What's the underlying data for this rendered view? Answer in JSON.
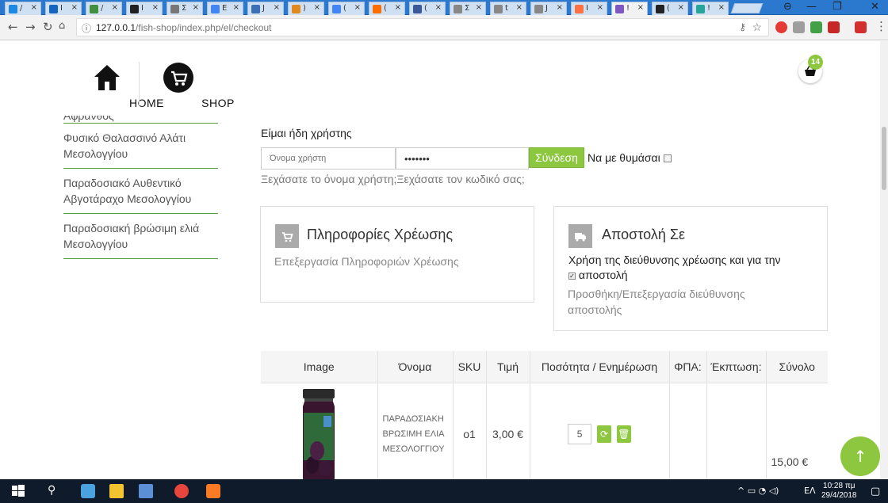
{
  "browser": {
    "tabs": [
      {
        "label": "/",
        "color": "#1e88e5"
      },
      {
        "label": "I",
        "color": "#1565c0"
      },
      {
        "label": "/",
        "color": "#3f8f3f"
      },
      {
        "label": "I",
        "color": "#222222"
      },
      {
        "label": "Σ",
        "color": "#777777"
      },
      {
        "label": "E",
        "color": "#4285f4"
      },
      {
        "label": "J",
        "color": "#3b6fb6"
      },
      {
        "label": ")",
        "color": "#e08a1e"
      },
      {
        "label": "(",
        "color": "#4285f4"
      },
      {
        "label": "(",
        "color": "#ff6d00"
      },
      {
        "label": "(",
        "color": "#3b5998"
      },
      {
        "label": "Σ",
        "color": "#888888"
      },
      {
        "label": "t",
        "color": "#888888"
      },
      {
        "label": "J",
        "color": "#888888"
      },
      {
        "label": "I",
        "color": "#ff7043"
      },
      {
        "label": "!",
        "color": "#7e57c2"
      },
      {
        "label": "(",
        "color": "#222222"
      },
      {
        "label": "!",
        "color": "#26a69a"
      }
    ],
    "url_host": "127.0.0.1",
    "url_path": "/fish-shop/index.php/el/checkout"
  },
  "nav": {
    "home_label": "HOME",
    "shop_label": "SHOP"
  },
  "cart": {
    "count": "14"
  },
  "sidebar": {
    "items": [
      {
        "label": "Αφρανθός"
      },
      {
        "label": "Φυσικό Θαλασσινό Αλάτι Μεσολογγίου"
      },
      {
        "label": "Παραδοσιακό Αυθεντικό Αβγοτάραχο Μεσολογγίου"
      },
      {
        "label": "Παραδοσιακή βρώσιμη ελιά Μεσολογγίου"
      }
    ]
  },
  "login": {
    "title": "Είμαι ήδη χρήστης",
    "username_placeholder": "Όνομα χρήστη",
    "password_value": "•••••••",
    "login_button": "Σύνδεση",
    "remember_label": "Να με θυμάσαι",
    "forgot_username": "Ξεχάσατε το όνομα χρήστη;",
    "forgot_password": "Ξεχάσατε τον κωδικό σας;"
  },
  "billing": {
    "title": "Πληροφορίες Χρέωσης",
    "edit_link": "Επεξεργασία Πληροφοριών Χρέωσης"
  },
  "shipping": {
    "title": "Αποστολή Σε",
    "same_address_text": "Χρήση της διεύθυνσης χρέωσης και για την",
    "same_address_text2": "αποστολή",
    "edit_link_line1": "Προσθήκη/Επεξεργασία διεύθυνσης",
    "edit_link_line2": "αποστολής"
  },
  "cart_table": {
    "headers": [
      "Image",
      "Όνομα",
      "SKU",
      "Τιμή",
      "Ποσότητα / Ενημέρωση",
      "ΦΠΑ:",
      "Έκπτωση:",
      "Σύνολο"
    ],
    "row": {
      "name_line1": "ΠΑΡΑΔΟΣΙΑΚΗ",
      "name_line2": "ΒΡΩΣΙΜΗ ΕΛΙΑ",
      "name_line3": "ΜΕΣΟΛΟΓΓΙΟΥ",
      "sku": "ο1",
      "price": "3,00 €",
      "quantity": "5",
      "vat": "",
      "discount": "",
      "total": "15,00 €"
    }
  },
  "taskbar": {
    "language": "ΕΛ",
    "time": "10:28 πμ",
    "date": "29/4/2018"
  },
  "colors": {
    "accent": "#8dc63f",
    "sidebar_rule": "#5a9e3c"
  }
}
